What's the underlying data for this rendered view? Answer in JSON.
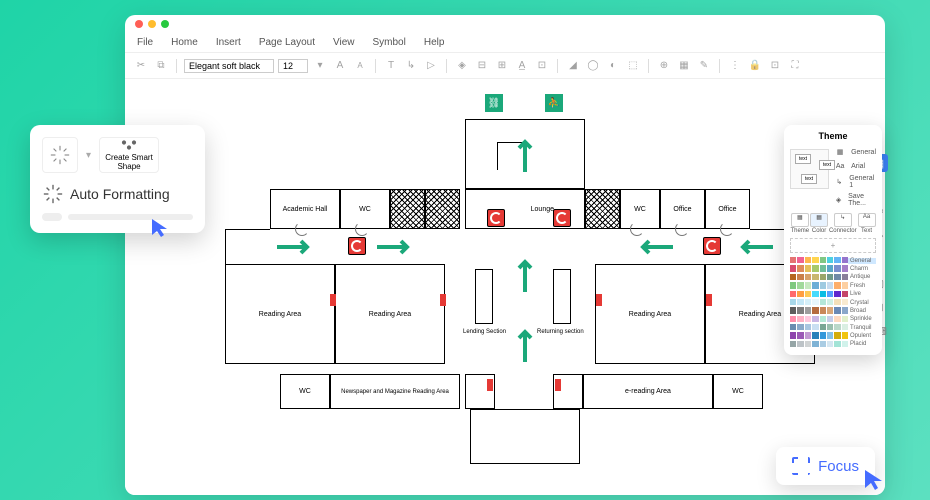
{
  "menu": {
    "file": "File",
    "home": "Home",
    "insert": "Insert",
    "page_layout": "Page Layout",
    "view": "View",
    "symbol": "Symbol",
    "help": "Help"
  },
  "toolbar": {
    "font": "Elegant soft black",
    "size": "12"
  },
  "popover": {
    "create_smart": "Create Smart\nShape",
    "auto_formatting": "Auto Formatting"
  },
  "theme": {
    "title": "Theme",
    "items": {
      "general": "General",
      "arial": "Arial",
      "general1": "General 1",
      "save": "Save The..."
    },
    "tabs": {
      "theme": "Theme",
      "color": "Color",
      "connector": "Connector",
      "text": "Text"
    },
    "add": "+",
    "palettes": [
      "General",
      "Charm",
      "Antique",
      "Fresh",
      "Live",
      "Crystal",
      "Broad",
      "Sprinkle",
      "Tranquil",
      "Opulent",
      "Placid"
    ]
  },
  "floor": {
    "academic_hall": "Academic Hall",
    "wc": "WC",
    "lounge": "Lounge",
    "office": "Office",
    "reading_area": "Reading Area",
    "lending": "Lending Section",
    "returning": "Returning section",
    "newspaper": "Newspaper and Magazine Reading Area",
    "ereading": "e-reading Area"
  },
  "focus": {
    "label": "Focus"
  },
  "colors": {
    "accent": "#456cff",
    "green": "#1ba87a",
    "red": "#e53935"
  },
  "palette_colors": [
    [
      "#e57373",
      "#f06292",
      "#ffb74d",
      "#ffd54f",
      "#81c784",
      "#4dd0e1",
      "#64b5f6",
      "#9575cd"
    ],
    [
      "#d84c6f",
      "#e08b5a",
      "#e6c05a",
      "#a7c96a",
      "#6fbf9a",
      "#5aa7c9",
      "#7a8fcf",
      "#a57fc9"
    ],
    [
      "#b5651d",
      "#c97f4a",
      "#d8a26a",
      "#c9b76f",
      "#9aa76a",
      "#6f9a8a",
      "#6f8aa7",
      "#8a7f9a"
    ],
    [
      "#7fc97f",
      "#a1d99b",
      "#c7e9c0",
      "#6baed6",
      "#9ecae1",
      "#c6dbef",
      "#fdae6b",
      "#fdd0a2"
    ],
    [
      "#ff6b6b",
      "#ff9f43",
      "#feca57",
      "#48dbfb",
      "#0abde3",
      "#54a0ff",
      "#5f27cd",
      "#c44569"
    ],
    [
      "#a8d8ea",
      "#c5e8f7",
      "#d6f0fa",
      "#e8f6fc",
      "#b4e7d8",
      "#d0f0e5",
      "#f4e0b9",
      "#f8ead0"
    ],
    [
      "#5d5d5d",
      "#7d7d7d",
      "#9d9d9d",
      "#b56b3f",
      "#c9895a",
      "#d9a87a",
      "#6b8ab5",
      "#8aa7c9"
    ],
    [
      "#ff8fab",
      "#ffb3c6",
      "#ffc9de",
      "#c9b6e4",
      "#b5ead7",
      "#c7ceea",
      "#ffdac1",
      "#e2f0cb"
    ],
    [
      "#6a8caf",
      "#8aa9c9",
      "#a9c6e0",
      "#c9dff2",
      "#7aa795",
      "#9ac0af",
      "#bad8c9",
      "#daefe2"
    ],
    [
      "#8e44ad",
      "#9b59b6",
      "#c39bd3",
      "#2980b9",
      "#3498db",
      "#85c1e9",
      "#d4ac0d",
      "#f1c40f"
    ],
    [
      "#95a5a6",
      "#bdc3c7",
      "#d0d3d4",
      "#7fb3d5",
      "#a9cce3",
      "#d4e6f1",
      "#a3e4d7",
      "#d1f2eb"
    ]
  ]
}
